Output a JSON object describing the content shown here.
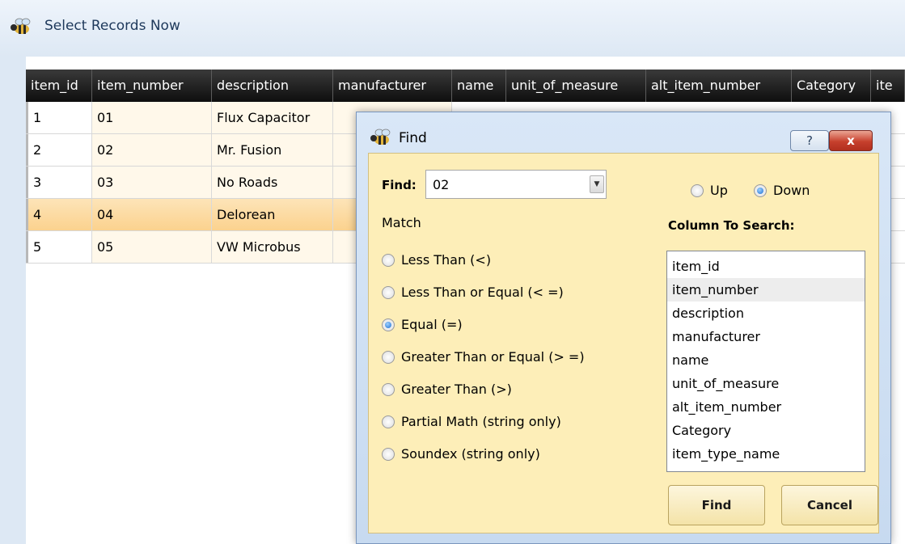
{
  "window": {
    "title": "Select Records Now"
  },
  "grid": {
    "columns": [
      "item_id",
      "item_number",
      "description",
      "manufacturer",
      "name",
      "unit_of_measure",
      "alt_item_number",
      "Category",
      "ite"
    ],
    "rows": [
      {
        "item_id": "1",
        "item_number": "01",
        "description": "Flux Capacitor"
      },
      {
        "item_id": "2",
        "item_number": "02",
        "description": "Mr. Fusion"
      },
      {
        "item_id": "3",
        "item_number": "03",
        "description": "No Roads"
      },
      {
        "item_id": "4",
        "item_number": "04",
        "description": "Delorean"
      },
      {
        "item_id": "5",
        "item_number": "05",
        "description": "VW Microbus"
      }
    ],
    "selected_row": 3
  },
  "dialog": {
    "title": "Find",
    "help_label": "?",
    "close_label": "x",
    "find_label": "Find:",
    "find_value": "02",
    "direction": {
      "up_label": "Up",
      "down_label": "Down",
      "selected": "Down"
    },
    "match_label": "Match",
    "match_options": [
      "Less Than (<)",
      "Less Than or Equal (< =)",
      "Equal (=)",
      "Greater Than or Equal (> =)",
      "Greater Than (>)",
      "Partial Math (string only)",
      "Soundex (string only)"
    ],
    "match_selected": 2,
    "column_label": "Column To Search:",
    "columns": [
      "item_id",
      "item_number",
      "description",
      "manufacturer",
      "name",
      "unit_of_measure",
      "alt_item_number",
      "Category",
      "item_type_name"
    ],
    "column_selected": 1,
    "find_button_label": "Find",
    "cancel_button_label": "Cancel"
  }
}
